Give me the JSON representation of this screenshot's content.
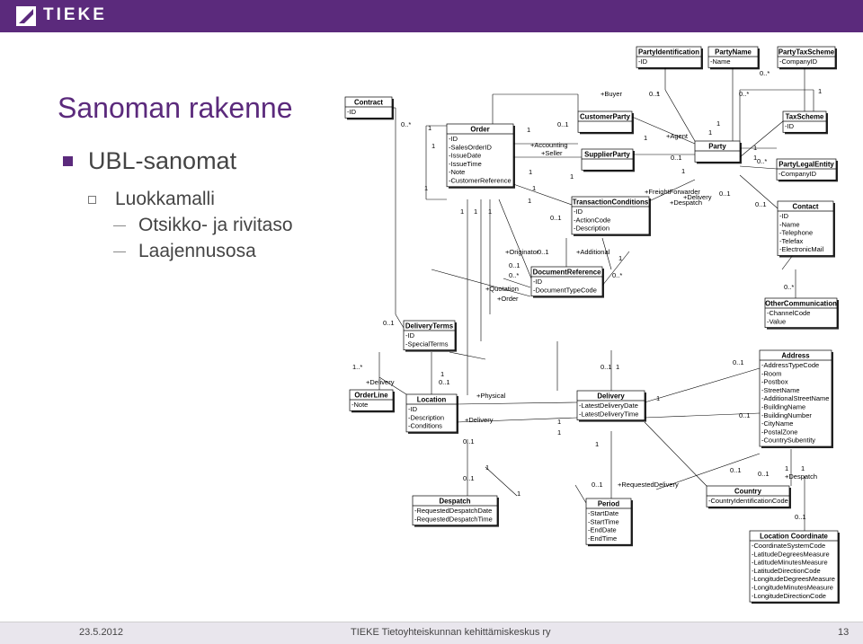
{
  "header": {
    "logo_text": "TIEKE"
  },
  "slide": {
    "title": "Sanoman rakenne",
    "bullets": [
      "UBL-sanomat",
      "Luokkamalli",
      "Otsikko- ja rivitaso",
      "Laajennusosa"
    ]
  },
  "footer": {
    "date": "23.5.2012",
    "org": "TIEKE  Tietoyhteiskunnan kehittämiskeskus ry",
    "page": "13"
  },
  "diagram": {
    "classes": [
      {
        "name": "Contract",
        "attrs": [
          "-ID"
        ]
      },
      {
        "name": "Order",
        "attrs": [
          "-ID",
          "-SalesOrderID",
          "-IssueDate",
          "-IssueTime",
          "-Note",
          "-CustomerReference"
        ]
      },
      {
        "name": "CustomerParty",
        "attrs": []
      },
      {
        "name": "SupplierParty",
        "attrs": []
      },
      {
        "name": "TransactionConditions",
        "attrs": [
          "-ID",
          "-ActionCode",
          "-Description"
        ]
      },
      {
        "name": "DocumentReference",
        "attrs": [
          "-ID",
          "-DocumentTypeCode"
        ]
      },
      {
        "name": "PartyIdentification",
        "attrs": [
          "-ID"
        ]
      },
      {
        "name": "PartyName",
        "attrs": [
          "-Name"
        ]
      },
      {
        "name": "PartyTaxScheme",
        "attrs": [
          "-CompanyID"
        ]
      },
      {
        "name": "TaxScheme",
        "attrs": [
          "-ID"
        ]
      },
      {
        "name": "Party",
        "attrs": []
      },
      {
        "name": "PartyLegalEntity",
        "attrs": [
          "-CompanyID"
        ]
      },
      {
        "name": "Contact",
        "attrs": [
          "-ID",
          "-Name",
          "-Telephone",
          "-Telefax",
          "-ElectronicMail"
        ]
      },
      {
        "name": "OtherCommunication",
        "attrs": [
          "-ChannelCode",
          "-Value"
        ]
      },
      {
        "name": "DeliveryTerms",
        "attrs": [
          "-ID",
          "-SpecialTerms"
        ]
      },
      {
        "name": "OrderLine",
        "attrs": [
          "-Note"
        ]
      },
      {
        "name": "Location",
        "attrs": [
          "-ID",
          "-Description",
          "-Conditions"
        ]
      },
      {
        "name": "Delivery",
        "attrs": [
          "-LatestDeliveryDate",
          "-LatestDeliveryTime"
        ]
      },
      {
        "name": "Address",
        "attrs": [
          "-AddressTypeCode",
          "-Room",
          "-Postbox",
          "-StreetName",
          "-AdditionalStreetName",
          "-BuildingName",
          "-BuildingNumber",
          "-CityName",
          "-PostalZone",
          "-CountrySubentity"
        ]
      },
      {
        "name": "Despatch",
        "attrs": [
          "-RequestedDespatchDate",
          "-RequestedDespatchTime"
        ]
      },
      {
        "name": "Period",
        "attrs": [
          "-StartDate",
          "-StartTime",
          "-EndDate",
          "-EndTime"
        ]
      },
      {
        "name": "Country",
        "attrs": [
          "-CountryIdentificationCode"
        ]
      },
      {
        "name": "Location Coordinate",
        "attrs": [
          "-CoordinateSystemCode",
          "-LatitudeDegreesMeasure",
          "-LatitudeMinutesMeasure",
          "-LatitudeDirectionCode",
          "-LongitudeDegreesMeasure",
          "-LongitudeMinutesMeasure",
          "-LongitudeDirectionCode"
        ]
      }
    ],
    "labels": [
      "+Buyer",
      "+Agent",
      "+Accounting",
      "+Seller",
      "+FreightForwarder",
      "+Delivery",
      "+Despatch",
      "+Originator",
      "+Additional",
      "+Quotation",
      "+Order",
      "+Delivery",
      "+Physical",
      "+Delivery",
      "+RequestedDelivery",
      "+Despatch",
      "0..*",
      "0..1",
      "1",
      "1..*"
    ]
  }
}
